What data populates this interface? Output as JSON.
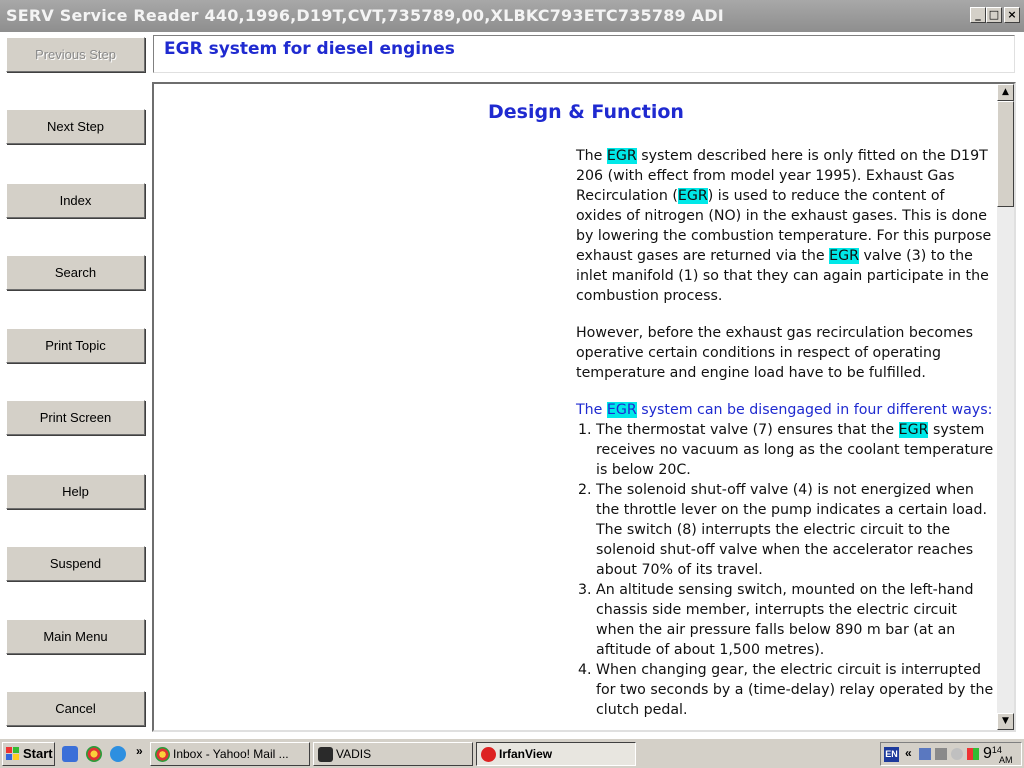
{
  "window": {
    "title": "SERV Service Reader 440,1996,D19T,CVT,735789,00,XLBKC793ETC735789 ADI",
    "minimize": "_",
    "maximize": "□",
    "close": "×"
  },
  "nav": {
    "previous_step": "Previous Step",
    "next_step": "Next Step",
    "index": "Index",
    "search": "Search",
    "print_topic": "Print Topic",
    "print_screen": "Print Screen",
    "help": "Help",
    "suspend": "Suspend",
    "main_menu": "Main Menu",
    "cancel": "Cancel"
  },
  "topic": {
    "title": "EGR system for diesel engines"
  },
  "content": {
    "heading": "Design & Function",
    "hl": "EGR",
    "p1": {
      "a": "The ",
      "b": " system described here is only fitted on the D19T 206 (with effect from model year 1995). Exhaust Gas Recirculation (",
      "c": ") is used to reduce the content of oxides of nitrogen (NO) in the exhaust gases. This is done by lowering the combustion temperature. For this purpose exhaust gases are returned via the ",
      "d": " valve (3) to the inlet manifold (1) so that they can again participate in the combustion process."
    },
    "p2": "However, before the exhaust gas recirculation becomes operative certain conditions in respect of operating temperature and engine load have to be fulfilled.",
    "p3": {
      "a": "The ",
      "b": " system can be disengaged in four different ways:"
    },
    "list": {
      "item1_a": "The thermostat valve (7) ensures that the ",
      "item1_b": " system receives no vacuum as long as the coolant temperature is below 20C.",
      "item2": "The solenoid shut-off valve (4) is not energized when the throttle lever on the pump indicates a certain load. The switch (8) interrupts the electric circuit to the solenoid shut-off valve when the accelerator reaches about 70% of its travel.",
      "item3": "An altitude sensing switch, mounted on the left-hand chassis side member, interrupts the electric circuit when the air pressure falls below 890 m bar (at an aftitude of about 1,500 metres).",
      "item4": "When changing gear, the electric circuit is interrupted for two seconds by a (time-delay) relay operated by the clutch pedal."
    }
  },
  "scrollbar": {
    "up": "▲",
    "down": "▼"
  },
  "taskbar": {
    "start": "Start",
    "chevron": "»",
    "tasks": {
      "inbox": "Inbox - Yahoo! Mail ...",
      "vadis": "VADIS",
      "irfanview": "IrfanView"
    },
    "tray_chevron": "«",
    "lang": "EN",
    "clock_hour": "9",
    "clock_min": "14",
    "clock_ampm": "AM"
  },
  "colors": {
    "heading_blue": "#1f2ad0",
    "highlight_cyan": "#00e8e8",
    "titlebar": "#9a9a9a",
    "button_face": "#d4d0c8"
  }
}
